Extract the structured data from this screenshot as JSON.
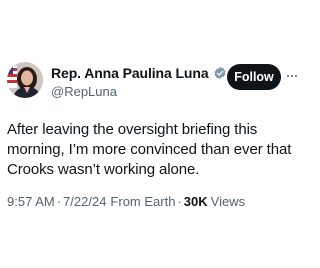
{
  "author": {
    "display_name": "Rep. Anna Paulina Luna",
    "handle": "@RepLuna",
    "verified_badge_icon": "government-verified-badge-icon",
    "badge_color": "#829aab"
  },
  "actions": {
    "follow_label": "Follow",
    "more_icon": "more-options-icon"
  },
  "tweet": {
    "text_lines": [
      "After leaving the oversight briefing this",
      "morning, I’m more convinced than ever that",
      "Crooks wasn’t working alone."
    ],
    "time": "9:57 AM",
    "date": "7/22/24",
    "source": "From Earth",
    "separator": "·",
    "views_count": "30K",
    "views_label": "Views"
  }
}
